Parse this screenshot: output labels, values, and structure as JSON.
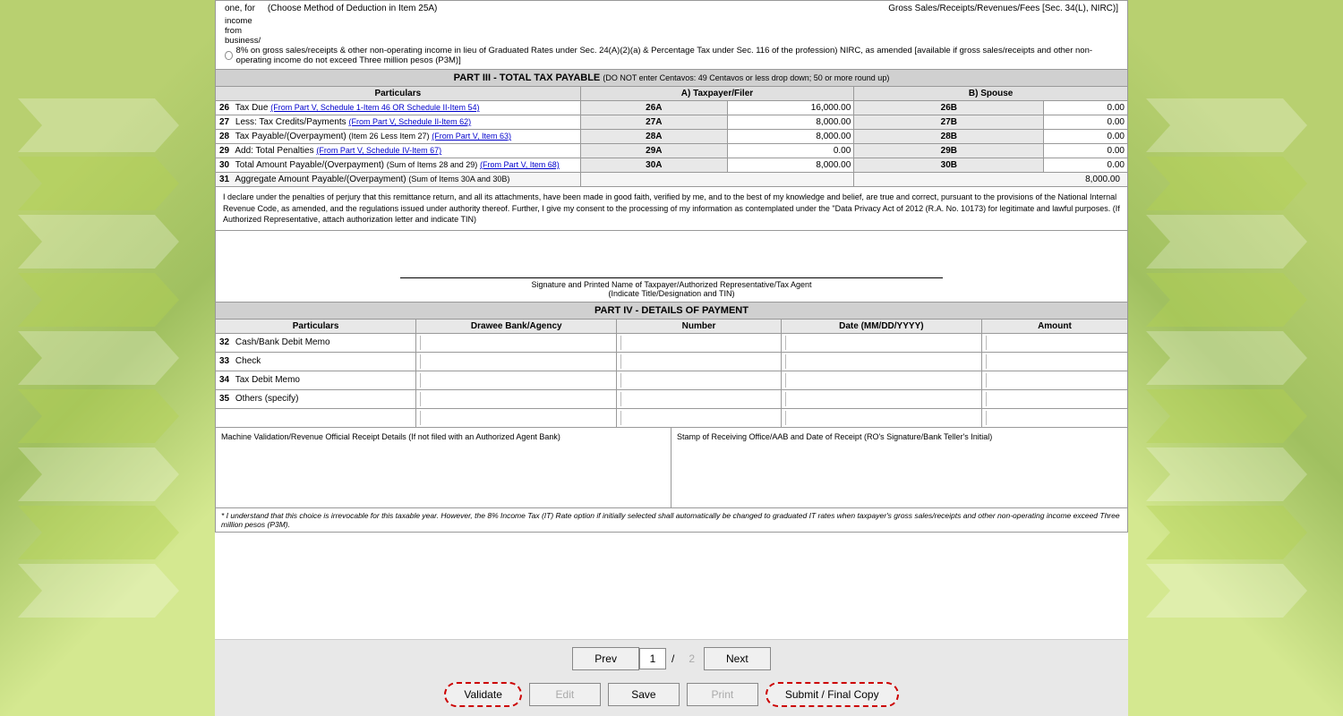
{
  "background": {
    "left_color": "#b8d070",
    "right_color": "#b8d070"
  },
  "top_section": {
    "line1": "one, for",
    "choice_label": "(Choose Method of Deduction in Item 25A)",
    "gross_sales_label": "Gross Sales/Receipts/Revenues/Fees [Sec. 34(L), NIRC)]",
    "rate_option": "8% on gross sales/receipts & other non-operating income in lieu of Graduated Rates under Sec. 24(A)(2)(a) & Percentage Tax under Sec. 116 of the profession) NIRC, as amended [available if gross sales/receipts and other non-operating income do not exceed Three million pesos (P3M)]"
  },
  "part3": {
    "title": "PART III - TOTAL TAX PAYABLE",
    "subtitle": "(DO NOT enter Centavos: 49 Centavos or less drop down; 50 or more round up)",
    "col_a": "A) Taxpayer/Filer",
    "col_b": "B) Spouse",
    "particulars_header": "Particulars",
    "rows": [
      {
        "num": "26",
        "label": "Tax Due",
        "link": "(From Part V, Schedule 1-Item 46 OR Schedule II-Item 54)",
        "code_a": "26A",
        "val_a": "16,000.00",
        "code_b": "26B",
        "val_b": "0.00"
      },
      {
        "num": "27",
        "label": "Less: Tax Credits/Payments",
        "link": "(From Part V, Schedule II-Item 62)",
        "code_a": "27A",
        "val_a": "8,000.00",
        "code_b": "27B",
        "val_b": "0.00"
      },
      {
        "num": "28",
        "label": "Tax Payable/(Overpayment)",
        "link2": "(Item 26 Less Item 27)",
        "link3": "(From Part V, Item 63)",
        "code_a": "28A",
        "val_a": "8,000.00",
        "code_b": "28B",
        "val_b": "0.00"
      },
      {
        "num": "29",
        "label": "Add: Total Penalties",
        "link": "(From Part V, Schedule IV-Item 67)",
        "code_a": "29A",
        "val_a": "0.00",
        "code_b": "29B",
        "val_b": "0.00"
      },
      {
        "num": "30",
        "label": "Total Amount Payable/(Overpayment)",
        "link": "(Sum of Items 28 and 29)",
        "link2": "(From Part V, Item 68)",
        "code_a": "30A",
        "val_a": "8,000.00",
        "code_b": "30B",
        "val_b": "0.00"
      }
    ],
    "row31": {
      "num": "31",
      "label": "Aggregate Amount Payable/(Overpayment)",
      "sublabel": "(Sum of Items 30A and 30B)",
      "value": "8,000.00"
    }
  },
  "declaration": {
    "text": "I declare under the penalties of perjury that this remittance return, and all its attachments, have been made in good faith, verified by me, and to the best of my knowledge and belief, are true and correct, pursuant to the provisions of the National Internal Revenue Code, as amended, and the regulations issued under authority thereof. Further, I give my consent to the processing of my information as contemplated under the \"Data Privacy Act of 2012 (R.A. No. 10173) for legitimate and lawful purposes. (If Authorized Representative, attach authorization letter and indicate TIN)"
  },
  "signature": {
    "line1": "Signature and Printed Name of Taxpayer/Authorized Representative/Tax Agent",
    "line2": "(Indicate Title/Designation and TIN)"
  },
  "part4": {
    "title": "PART IV - DETAILS OF PAYMENT",
    "headers": [
      "Particulars",
      "Drawee Bank/Agency",
      "Number",
      "Date (MM/DD/YYYY)",
      "Amount"
    ],
    "rows": [
      {
        "num": "32",
        "label": "Cash/Bank Debit Memo"
      },
      {
        "num": "33",
        "label": "Check"
      },
      {
        "num": "34",
        "label": "Tax Debit Memo"
      },
      {
        "num": "35",
        "label": "Others (specify)"
      }
    ]
  },
  "stamp": {
    "left_label": "Machine Validation/Revenue Official Receipt Details (If not filed with an Authorized Agent Bank)",
    "right_label": "Stamp of Receiving Office/AAB and Date of Receipt (RO's Signature/Bank Teller's Initial)"
  },
  "footnote": {
    "text": "* I understand that this choice is irrevocable for this taxable year. However, the 8% Income Tax (IT) Rate option if initially selected shall automatically be changed to graduated IT rates when taxpayer's gross sales/receipts and other non-operating income exceed Three million pesos (P3M)."
  },
  "nav": {
    "prev_label": "Prev",
    "next_label": "Next",
    "current_page": "1",
    "total_pages": "2"
  },
  "actions": {
    "validate_label": "Validate",
    "edit_label": "Edit",
    "save_label": "Save",
    "print_label": "Print",
    "submit_label": "Submit / Final Copy"
  }
}
